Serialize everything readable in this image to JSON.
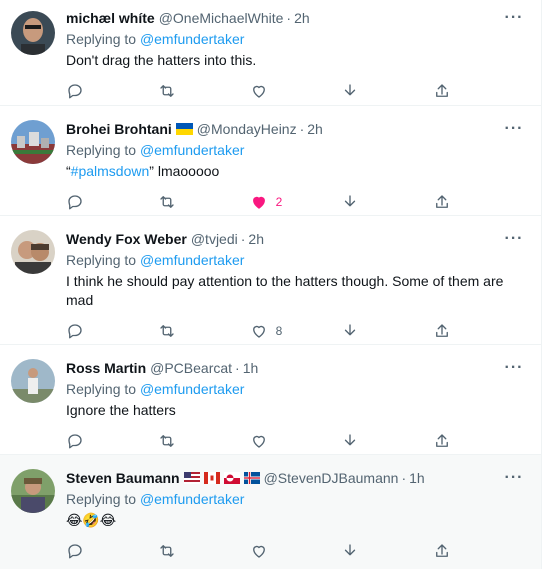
{
  "replying_label": "Replying to",
  "more_label": "···",
  "tweets": [
    {
      "name": "michæl whíte",
      "handle": "@OneMichaelWhite",
      "time": "2h",
      "mention": "@emfundertaker",
      "text": "Don't drag the hatters into this.",
      "likes": ""
    },
    {
      "name": "Brohei Brohtani",
      "handle": "@MondayHeinz",
      "time": "2h",
      "mention": "@emfundertaker",
      "text_quote_open": "“",
      "hashtag": "#palmsdown",
      "text_rest": "” lmaooooo",
      "likes": "2"
    },
    {
      "name": "Wendy Fox Weber",
      "handle": "@tvjedi",
      "time": "2h",
      "mention": "@emfundertaker",
      "text": "I think he should pay attention to the hatters though. Some of them are mad",
      "likes": "8"
    },
    {
      "name": "Ross Martin",
      "handle": "@PCBearcat",
      "time": "1h",
      "mention": "@emfundertaker",
      "text": "Ignore the hatters",
      "likes": ""
    },
    {
      "name": "Steven Baumann",
      "handle": "@StevenDJBaumann",
      "time": "1h",
      "mention": "@emfundertaker",
      "text": "😂🤣😂",
      "likes": ""
    }
  ],
  "colors": {
    "accent": "#1d9bf0",
    "like": "#f91880",
    "muted": "#536471",
    "text": "#0f1419"
  }
}
